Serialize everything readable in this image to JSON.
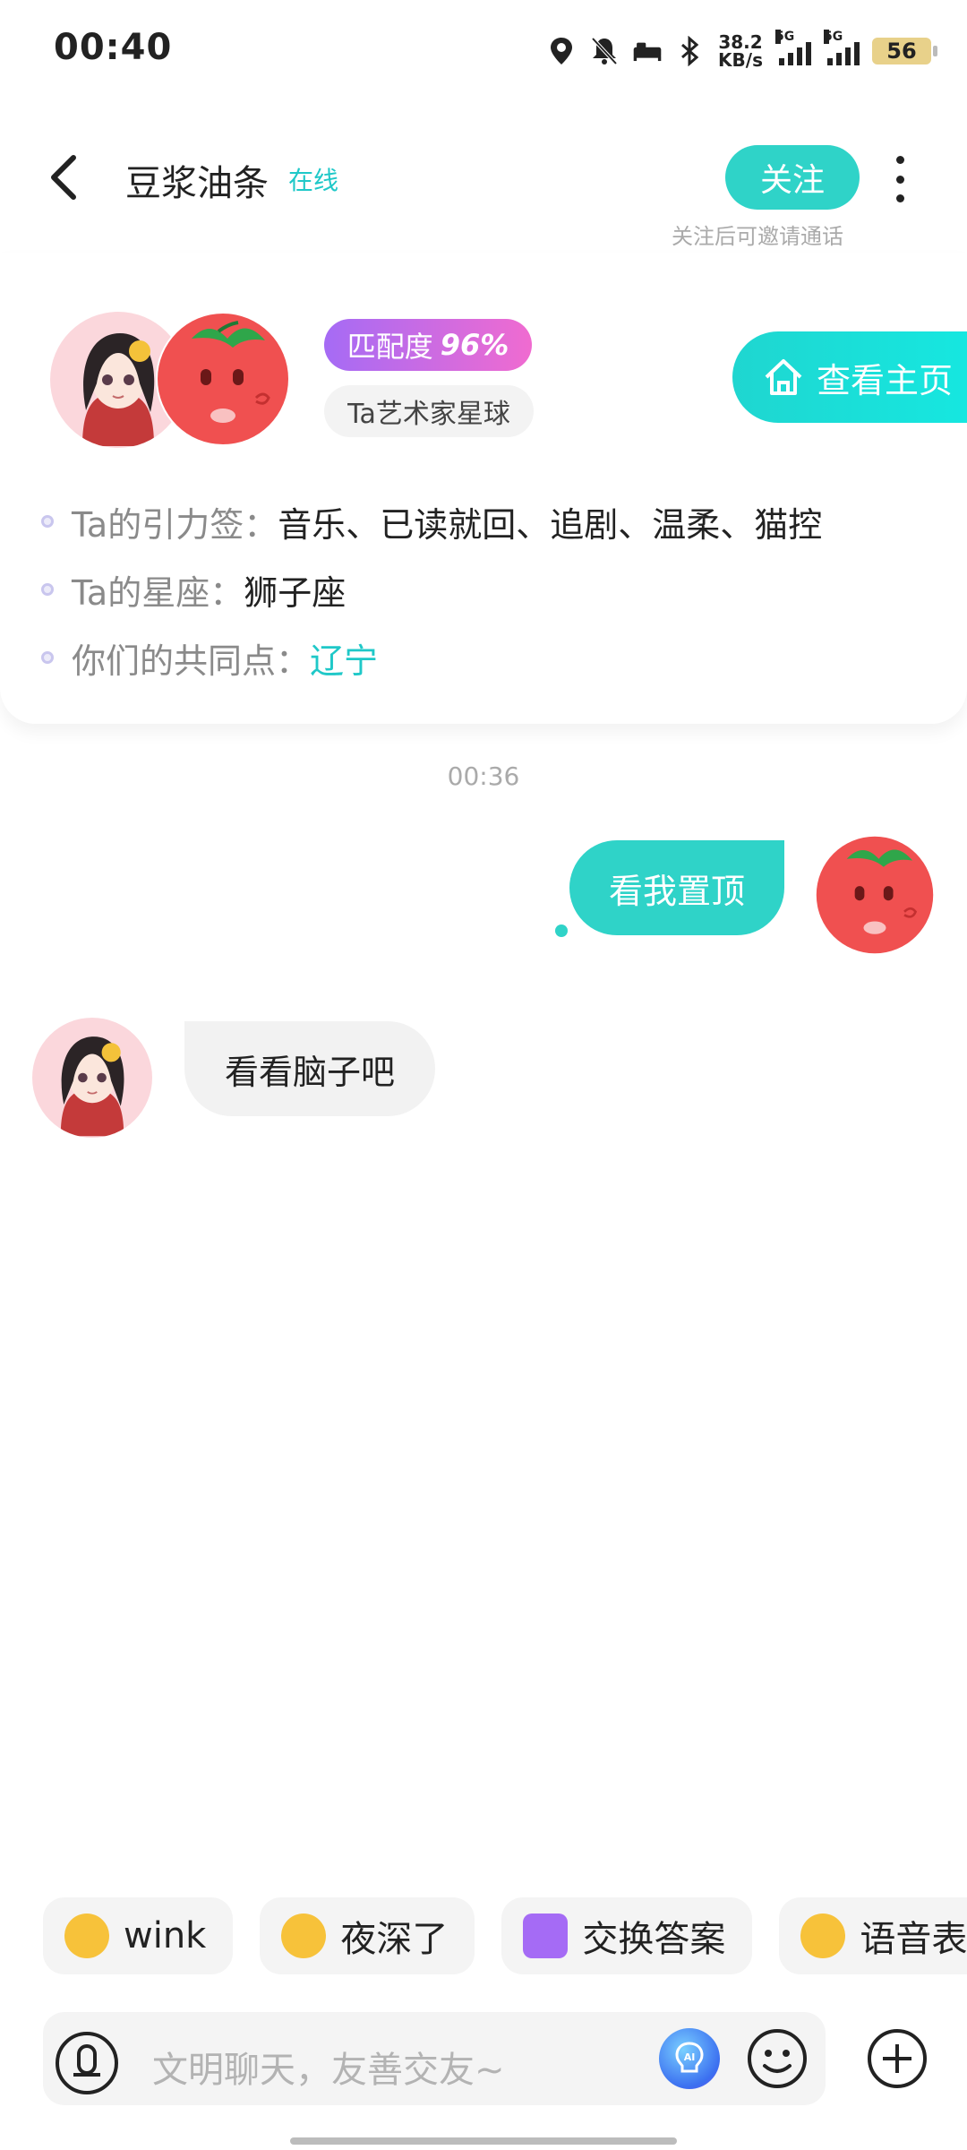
{
  "status_bar": {
    "time": "00:40",
    "net_speed_value": "38.2",
    "net_speed_unit": "KB/s",
    "sim1_label": "5G",
    "sim2_label": "5G",
    "battery": "56",
    "icons": [
      "location-icon",
      "mute-icon",
      "bed-icon",
      "bluetooth-icon",
      "signal-icon",
      "battery-icon"
    ]
  },
  "header": {
    "title": "豆浆油条",
    "status": "在线",
    "follow_label": "关注",
    "follow_hint": "关注后可邀请通话"
  },
  "profile_card": {
    "match_label": "匹配度",
    "match_value": "96%",
    "planet": "Ta艺术家星球",
    "homepage_label": "查看主页",
    "rows": [
      {
        "key": "Ta的引力签：",
        "value": "音乐、已读就回、追剧、温柔、猫控"
      },
      {
        "key": "Ta的星座：",
        "value": "狮子座"
      },
      {
        "key": "你们的共同点：",
        "value": "辽宁"
      }
    ]
  },
  "chat": {
    "timestamp": "00:36",
    "outgoing": "看我置顶",
    "incoming": "看看脑子吧"
  },
  "quick_replies": [
    {
      "label": "wink",
      "icon": "wink-emoji-icon"
    },
    {
      "label": "夜深了",
      "icon": "sleepy-emoji-icon"
    },
    {
      "label": "交换答案",
      "icon": "exchange-icon"
    },
    {
      "label": "语音表",
      "icon": "voice-emoji-icon"
    }
  ],
  "input": {
    "placeholder": "文明聊天，友善交友~"
  },
  "colors": {
    "accent": "#2fd3c8",
    "match_gradient_start": "#a56bf5",
    "match_gradient_end": "#f06bd0",
    "bubble_in": "#f2f2f2"
  }
}
